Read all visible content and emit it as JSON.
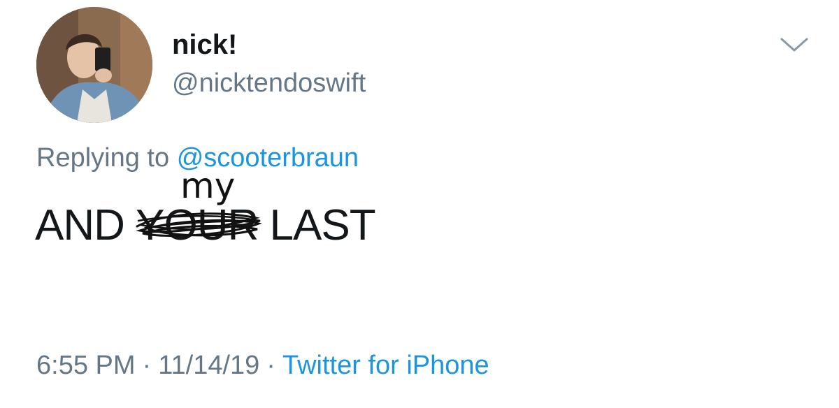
{
  "tweet": {
    "display_name": "nick!",
    "handle": "@nicktendoswift",
    "reply_prefix": "Replying to",
    "reply_to": "@scooterbraun",
    "body": {
      "word1": "AND",
      "struck_word": "YOUR",
      "word3": "LAST",
      "handwritten_insert": "my"
    },
    "time": "6:55 PM",
    "separator": "·",
    "date": "11/14/19",
    "source": "Twitter for iPhone"
  },
  "icons": {
    "caret": "chevron-down-icon",
    "avatar": "profile-photo"
  },
  "colors": {
    "link": "#1b95e0",
    "secondary_text": "#657786",
    "primary_text": "#14171a"
  }
}
